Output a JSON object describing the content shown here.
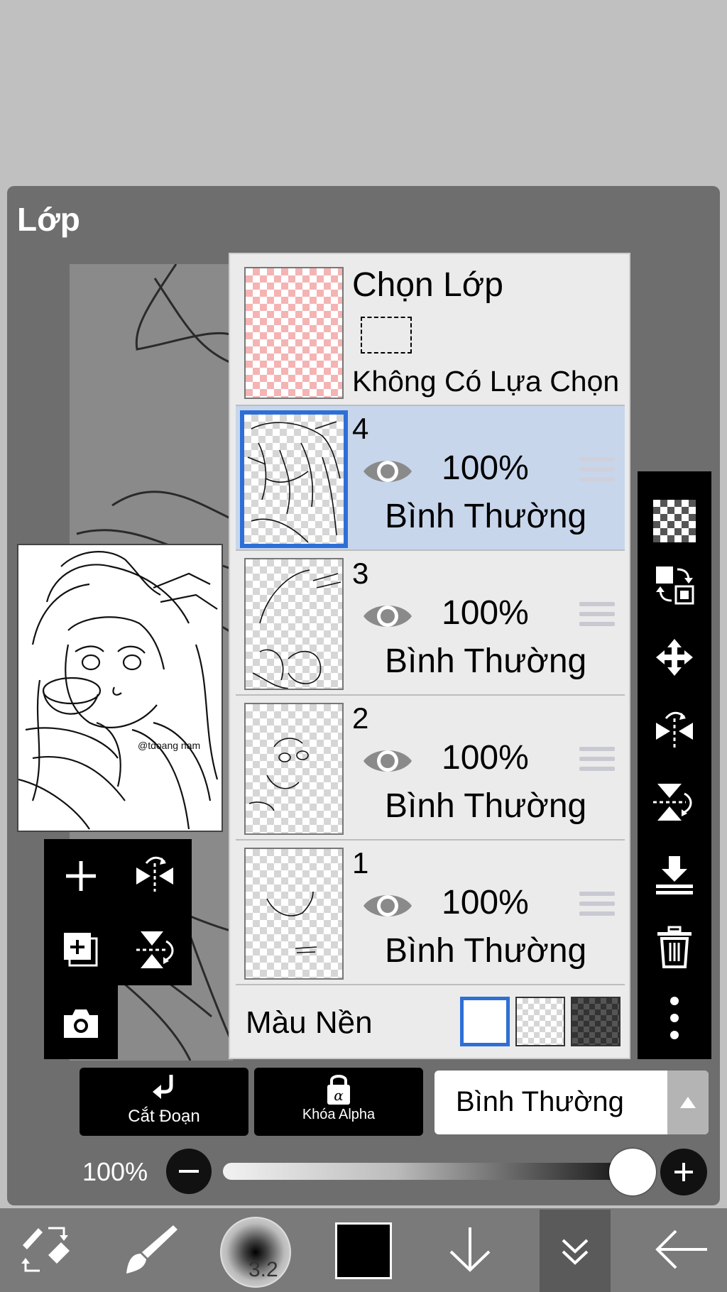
{
  "panel": {
    "title": "Lớp"
  },
  "preview": {
    "signature": "@tdoang nam"
  },
  "selection_layer": {
    "title": "Chọn Lớp",
    "subtitle": "Không Có Lựa Chọn"
  },
  "layers": [
    {
      "number": "4",
      "opacity": "100%",
      "mode": "Bình Thường",
      "selected": true
    },
    {
      "number": "3",
      "opacity": "100%",
      "mode": "Bình Thường",
      "selected": false
    },
    {
      "number": "2",
      "opacity": "100%",
      "mode": "Bình Thường",
      "selected": false
    },
    {
      "number": "1",
      "opacity": "100%",
      "mode": "Bình Thường",
      "selected": false
    }
  ],
  "background_color": {
    "label": "Màu Nền",
    "options": [
      "white",
      "transparent",
      "dark"
    ],
    "selected": "white"
  },
  "action_bar": {
    "clip_label": "Cắt Đoạn",
    "alpha_lock_label": "Khóa Alpha",
    "blend_mode": "Bình Thường"
  },
  "opacity_slider": {
    "label": "100%",
    "value": 1.0
  },
  "bottom_bar": {
    "brush_size": "3.2"
  },
  "colors": {
    "accent": "#2e6fd6",
    "selected_row": "#c8d6ec",
    "panel": "#6e6e6e"
  }
}
